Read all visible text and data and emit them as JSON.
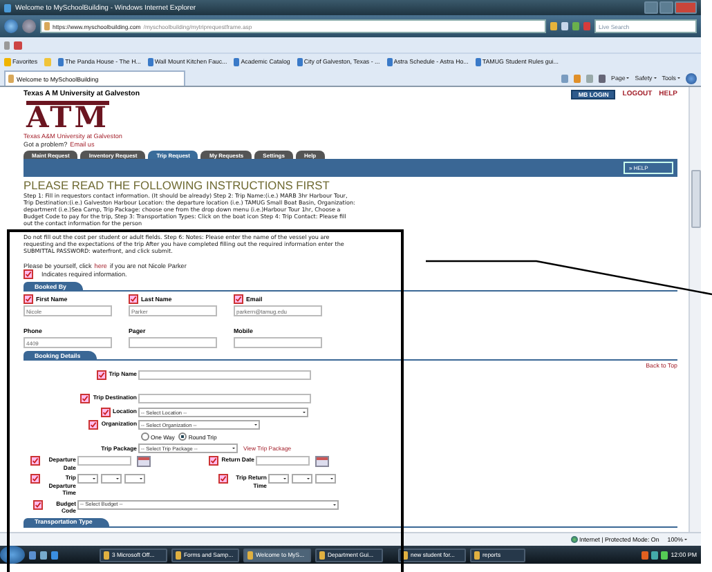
{
  "window": {
    "title": "Welcome to MySchoolBuilding - Windows Internet Explorer"
  },
  "address_bar": {
    "host": "https://www.myschoolbuilding.com",
    "path": "/myschoolbuilding/mytriprequestframe.asp"
  },
  "search": {
    "placeholder": "Live Search"
  },
  "favorites_bar": {
    "label": "Favorites",
    "items": [
      "The Panda House - The H...",
      "Wall Mount Kitchen Fauc...",
      "Academic Catalog",
      "City of Galveston, Texas - ...",
      "Astra Schedule - Astra Ho...",
      "TAMUG Student Rules gui..."
    ]
  },
  "browser_tabs": [
    {
      "label": "Welcome to MySchoolBuilding",
      "selected": true
    }
  ],
  "command_bar": [
    "Page",
    "Safety",
    "Tools"
  ],
  "page": {
    "header": {
      "title": "Texas A M University at Galveston",
      "login": "MB LOGIN",
      "links": [
        "LOGOUT",
        "HELP"
      ]
    },
    "logo": "ATM",
    "school_link": "Texas A&M University at Galveston",
    "problem": {
      "text": "Got a problem?",
      "link": "Email us"
    },
    "tabs": [
      {
        "label": "Maint Request",
        "selected": false
      },
      {
        "label": "Inventory Request",
        "selected": false
      },
      {
        "label": "Trip Request",
        "selected": true
      },
      {
        "label": "My Requests",
        "selected": false
      },
      {
        "label": "Settings",
        "selected": false
      },
      {
        "label": "Help",
        "selected": false
      }
    ],
    "help_button": "» HELP",
    "heading": "PLEASE READ THE FOLLOWING INSTRUCTIONS FIRST",
    "instructions": [
      "Step 1: Fill in requestors contact information. (It should be already) Step 2: Trip Name:(i.e.) MARB 3hr Harbour Tour, Trip Destination:(i.e.) Galveston Harbour Location: the departure location (i.e.) TAMUG Small Boat Basin, Organization: department (i.e.)Sea Camp, Trip Package: choose one from the drop down menu (i.e.)Harbour Tour 1hr, Choose a Budget Code to pay for the trip, Step 3: Transportation Types: Click on the boat icon Step 4: Trip Contact: Please fill out the contact information for the person",
      "Do not fill out the cost per student or adult fields. Step 6: Notes: Please enter the name of the vessel you are requesting and the expectations of the trip After you have completed filling out the required information enter the SUBMITTAL PASSWORD: waterfront, and click submit."
    ],
    "identity": {
      "before": "Please be yourself, click",
      "link": "here",
      "after": "if you are not Nicole Parker"
    },
    "required_note": "Indicates required information.",
    "booked_by": {
      "title": "Booked By",
      "fields": [
        {
          "label": "First Name",
          "required": true,
          "value": "Nicole"
        },
        {
          "label": "Last Name",
          "required": true,
          "value": "Parker"
        },
        {
          "label": "Email",
          "required": true,
          "value": "parkern@tamug.edu"
        },
        {
          "label": "Phone",
          "required": false,
          "value": "4409"
        },
        {
          "label": "Pager",
          "required": false
        },
        {
          "label": "Mobile",
          "required": false
        }
      ]
    },
    "booking_details": {
      "title": "Booking Details",
      "back_to_top": "Back to Top",
      "trip_name": {
        "label": "Trip Name",
        "required": true
      },
      "trip_destination": {
        "label": "Trip Destination",
        "required": true
      },
      "location": {
        "label": "Location",
        "required": true,
        "value": "-- Select Location --"
      },
      "organization": {
        "label": "Organization",
        "required": true,
        "value": "-- Select Organization --"
      },
      "trip_type": [
        {
          "label": "One Way",
          "selected": false
        },
        {
          "label": "Round Trip",
          "selected": true
        }
      ],
      "trip_package": {
        "label": "Trip Package",
        "required": false,
        "value": "-- Select Trip Package --",
        "link": "View Trip Package"
      },
      "dates": [
        {
          "label": "Departure Date",
          "required": true
        },
        {
          "label": "Return Date",
          "required": true
        }
      ],
      "times": [
        {
          "label": "Trip Departure Time",
          "required": true
        },
        {
          "label": "Trip Return Time",
          "required": true
        }
      ],
      "budget": {
        "label": "Budget Code",
        "required": true,
        "value": "-- Select Budget --"
      }
    },
    "transportation": {
      "title": "Transportation Type"
    }
  },
  "status_bar": {
    "zone": "Internet | Protected Mode: On",
    "zoom": "100%"
  },
  "taskbar": {
    "items": [
      {
        "label": "3 Microsoft Off...",
        "selected": false
      },
      {
        "label": "Forms and Samp...",
        "selected": false
      },
      {
        "label": "Welcome to MyS...",
        "selected": true
      },
      {
        "label": "Department Gui...",
        "selected": false
      },
      {
        "label": "new student for...",
        "selected": false
      },
      {
        "label": "reports",
        "selected": false
      }
    ],
    "clock": "12:00 PM"
  }
}
